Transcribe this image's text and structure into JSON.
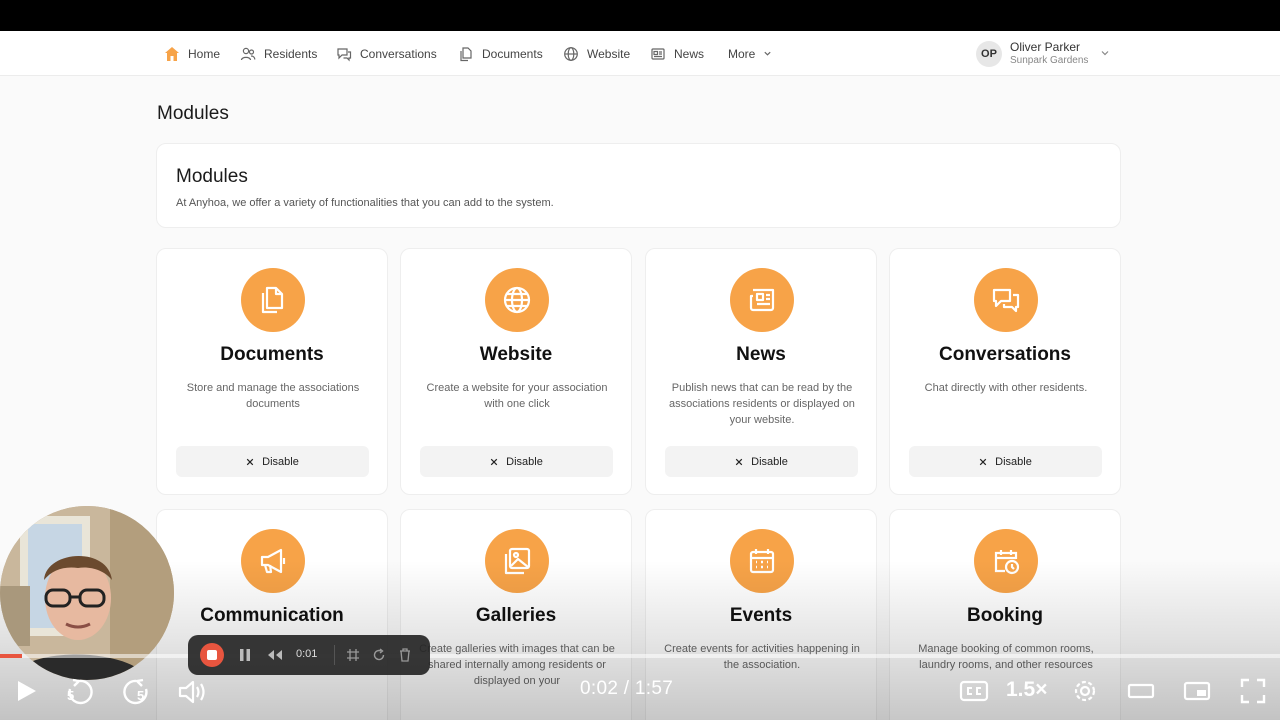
{
  "nav": {
    "items": [
      {
        "label": "Home",
        "icon": "home-icon"
      },
      {
        "label": "Residents",
        "icon": "users-icon"
      },
      {
        "label": "Conversations",
        "icon": "chat-icon"
      },
      {
        "label": "Documents",
        "icon": "documents-icon"
      },
      {
        "label": "Website",
        "icon": "globe-icon"
      },
      {
        "label": "News",
        "icon": "newspaper-icon"
      }
    ],
    "more_label": "More",
    "user": {
      "initials": "OP",
      "name": "Oliver Parker",
      "org": "Sunpark Gardens"
    }
  },
  "page": {
    "title": "Modules"
  },
  "intro": {
    "title": "Modules",
    "description": "At Anyhoa, we offer a variety of functionalities that you can add to the system."
  },
  "modules": [
    {
      "title": "Documents",
      "description": "Store and manage the associations documents",
      "button": "Disable",
      "icon": "documents-icon"
    },
    {
      "title": "Website",
      "description": "Create a website for your association with one click",
      "button": "Disable",
      "icon": "globe-icon"
    },
    {
      "title": "News",
      "description": "Publish news that can be read by the associations residents or displayed on your website.",
      "button": "Disable",
      "icon": "newspaper-icon"
    },
    {
      "title": "Conversations",
      "description": "Chat directly with other residents.",
      "button": "Disable",
      "icon": "chat-icon"
    },
    {
      "title": "Communication",
      "description": "",
      "icon": "megaphone-icon"
    },
    {
      "title": "Galleries",
      "description": "Create galleries with images that can be shared internally among residents or displayed on your",
      "icon": "gallery-icon"
    },
    {
      "title": "Events",
      "description": "Create events for activities happening in the association.",
      "icon": "calendar-icon"
    },
    {
      "title": "Booking",
      "description": "Manage booking of common rooms, laundry rooms, and other resources",
      "icon": "booking-icon"
    }
  ],
  "colors": {
    "accent": "#f7a348",
    "progress": "#e8553f"
  },
  "player": {
    "time": "0:02 / 1:57",
    "progress": 0.017,
    "speed": "1.5×",
    "rewind_seconds": "5",
    "forward_seconds": "5"
  },
  "recorder": {
    "elapsed": "0:01"
  }
}
